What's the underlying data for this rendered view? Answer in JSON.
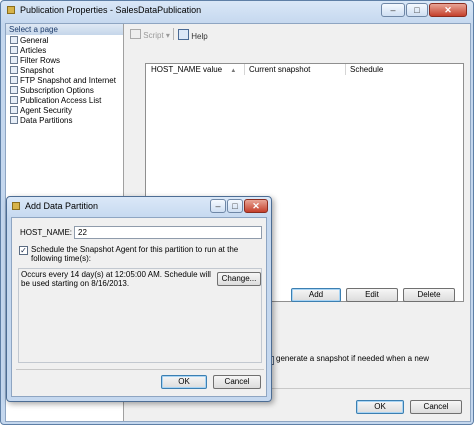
{
  "window": {
    "title": "Publication Properties - SalesDataPublication",
    "buttons": {
      "minimize": "–",
      "maximize": "□",
      "close": "✕"
    }
  },
  "left_pane": {
    "header": "Select a page",
    "items": [
      {
        "label": "General",
        "icon": "page-icon"
      },
      {
        "label": "Articles",
        "icon": "page-icon"
      },
      {
        "label": "Filter Rows",
        "icon": "page-icon"
      },
      {
        "label": "Snapshot",
        "icon": "page-icon"
      },
      {
        "label": "FTP Snapshot and Internet",
        "icon": "page-icon"
      },
      {
        "label": "Subscription Options",
        "icon": "page-icon"
      },
      {
        "label": "Publication Access List",
        "icon": "page-icon"
      },
      {
        "label": "Agent Security",
        "icon": "page-icon"
      },
      {
        "label": "Data Partitions",
        "icon": "page-icon"
      }
    ]
  },
  "toolbar": {
    "script": "Script",
    "script_arrow": "▾",
    "help": "Help"
  },
  "partitions_list": {
    "columns": [
      "HOST_NAME value",
      "Current snapshot",
      "Schedule"
    ],
    "sort_indicator": "▲"
  },
  "list_buttons": {
    "add": "Add",
    "edit": "Edit",
    "delete": "Delete"
  },
  "autogen_text": "generate a snapshot if needed when a new",
  "footer": {
    "ok": "OK",
    "cancel": "Cancel"
  },
  "dialog": {
    "title": "Add Data Partition",
    "buttons": {
      "minimize": "–",
      "maximize": "□",
      "close": "✕"
    },
    "host_name_label": "HOST_NAME:",
    "host_name_value": "22",
    "schedule_checkbox_checked": true,
    "schedule_checkbox_label": "Schedule the Snapshot Agent for this partition to run at the following time(s):",
    "schedule_description": "Occurs every 14 day(s) at 12:05:00 AM. Schedule will be used starting on 8/16/2013.",
    "change_button": "Change...",
    "ok": "OK",
    "cancel": "Cancel"
  },
  "colors": {
    "accent": "#3c7fb1",
    "title_bar": "#c4d7ee",
    "close_button": "#c4402c"
  }
}
